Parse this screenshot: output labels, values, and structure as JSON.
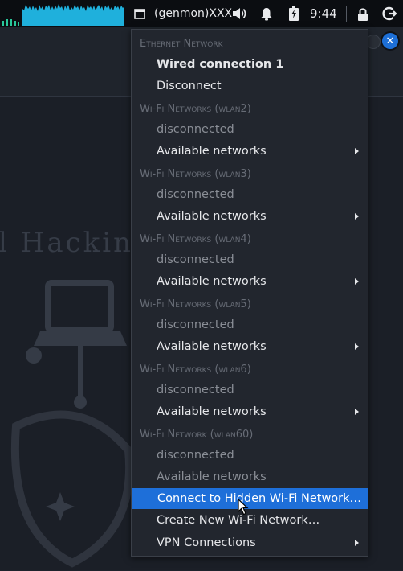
{
  "panel": {
    "genmon_label": "(genmon)XXX",
    "clock": "9:44",
    "icons": [
      "cpu-graph",
      "window-icon",
      "volume-icon",
      "bell-icon",
      "battery-icon",
      "lock-icon",
      "logout-icon"
    ],
    "colors": {
      "panel_bg": "#0b0d11",
      "cpu_graph": "#1fb0dc",
      "cpu_graph_low": "#29c79a"
    }
  },
  "wallpaper": {
    "text": "l Hacking"
  },
  "window_controls": {
    "close_glyph": "✕"
  },
  "menu": {
    "ethernet": {
      "header": "Ethernet Network",
      "connection": "Wired connection 1",
      "disconnect": "Disconnect"
    },
    "wifi_sections": [
      {
        "header": "Wi-Fi Networks (wlan2)",
        "status": "disconnected",
        "available": "Available networks"
      },
      {
        "header": "Wi-Fi Networks (wlan3)",
        "status": "disconnected",
        "available": "Available networks"
      },
      {
        "header": "Wi-Fi Networks (wlan4)",
        "status": "disconnected",
        "available": "Available networks"
      },
      {
        "header": "Wi-Fi Networks (wlan5)",
        "status": "disconnected",
        "available": "Available networks"
      },
      {
        "header": "Wi-Fi Networks (wlan6)",
        "status": "disconnected",
        "available": "Available networks"
      },
      {
        "header": "Wi-Fi Network (wlan60)",
        "status": "disconnected",
        "available": "Available networks"
      }
    ],
    "connect_hidden": "Connect to Hidden Wi-Fi Network…",
    "create_new": "Create New Wi-Fi Network…",
    "vpn": "VPN Connections",
    "colors": {
      "menu_bg": "#22262e",
      "highlight": "#1e6fd9",
      "header_text": "#676c76"
    }
  }
}
